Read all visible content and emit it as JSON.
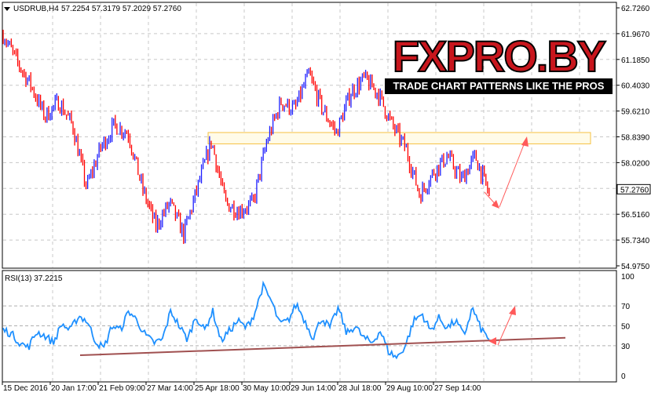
{
  "header": {
    "symbol": "USDRUB,H4",
    "ohlc": "57.2254 57.3179 57.2029 57.2760"
  },
  "price_axis": {
    "labels": [
      "62.7260",
      "61.9670",
      "61.1850",
      "60.4030",
      "59.6210",
      "58.8390",
      "58.0200",
      "57.2380",
      "56.5160",
      "55.7340",
      "54.9750"
    ],
    "min": 54.975,
    "max": 62.726,
    "current": "57.2760"
  },
  "rsi": {
    "label": "RSI(13) 37.2215",
    "levels": [
      "100",
      "70",
      "50",
      "30",
      "0"
    ]
  },
  "time_axis": {
    "labels": [
      "15 Dec 2016",
      "20 Jan 17:00",
      "21 Feb 09:00",
      "27 Mar 14:00",
      "25 Apr 18:00",
      "30 May 10:00",
      "29 Jun 14:00",
      "28 Jul 18:00",
      "29 Aug 10:00",
      "27 Sep 14:00"
    ]
  },
  "logo": {
    "title": "FXPRO.BY",
    "tagline": "TRADE CHART PATTERNS LIKE THE PROS"
  },
  "colors": {
    "bull": "#1e1eff",
    "bear": "#ff0000",
    "rsi": "#1e90ff",
    "arrow": "#ff5a5a",
    "trend": "#a05050",
    "zone": "#f5c040"
  },
  "chart_data": {
    "type": "candlestick",
    "price_path": [
      61.93,
      61.1,
      60.4,
      59.46,
      59.9,
      59.2,
      57.33,
      58.5,
      59.2,
      58.97,
      57.33,
      56.16,
      56.86,
      55.92,
      57.33,
      58.73,
      56.86,
      56.63,
      56.86,
      58.73,
      59.9,
      59.67,
      60.73,
      59.67,
      58.97,
      60.16,
      60.6,
      60.16,
      59.2,
      58.5,
      57.09,
      57.8,
      58.27,
      57.56,
      58.27,
      57.1
    ],
    "rsi_path": [
      46,
      42,
      33,
      28,
      44,
      40,
      33,
      52,
      45,
      60,
      55,
      35,
      27,
      50,
      46,
      65,
      55,
      40,
      33,
      36,
      65,
      50,
      36,
      60,
      45,
      65,
      35,
      45,
      55,
      48,
      62,
      90,
      75,
      52,
      55,
      72,
      55,
      38,
      58,
      48,
      68,
      42,
      50,
      38,
      33,
      45,
      24,
      18,
      30,
      55,
      62,
      45,
      58,
      48,
      55,
      40,
      68,
      47,
      37
    ],
    "resistance_zone": [
      58.98,
      58.64
    ],
    "rsi_trendline": [
      22,
      38
    ]
  }
}
